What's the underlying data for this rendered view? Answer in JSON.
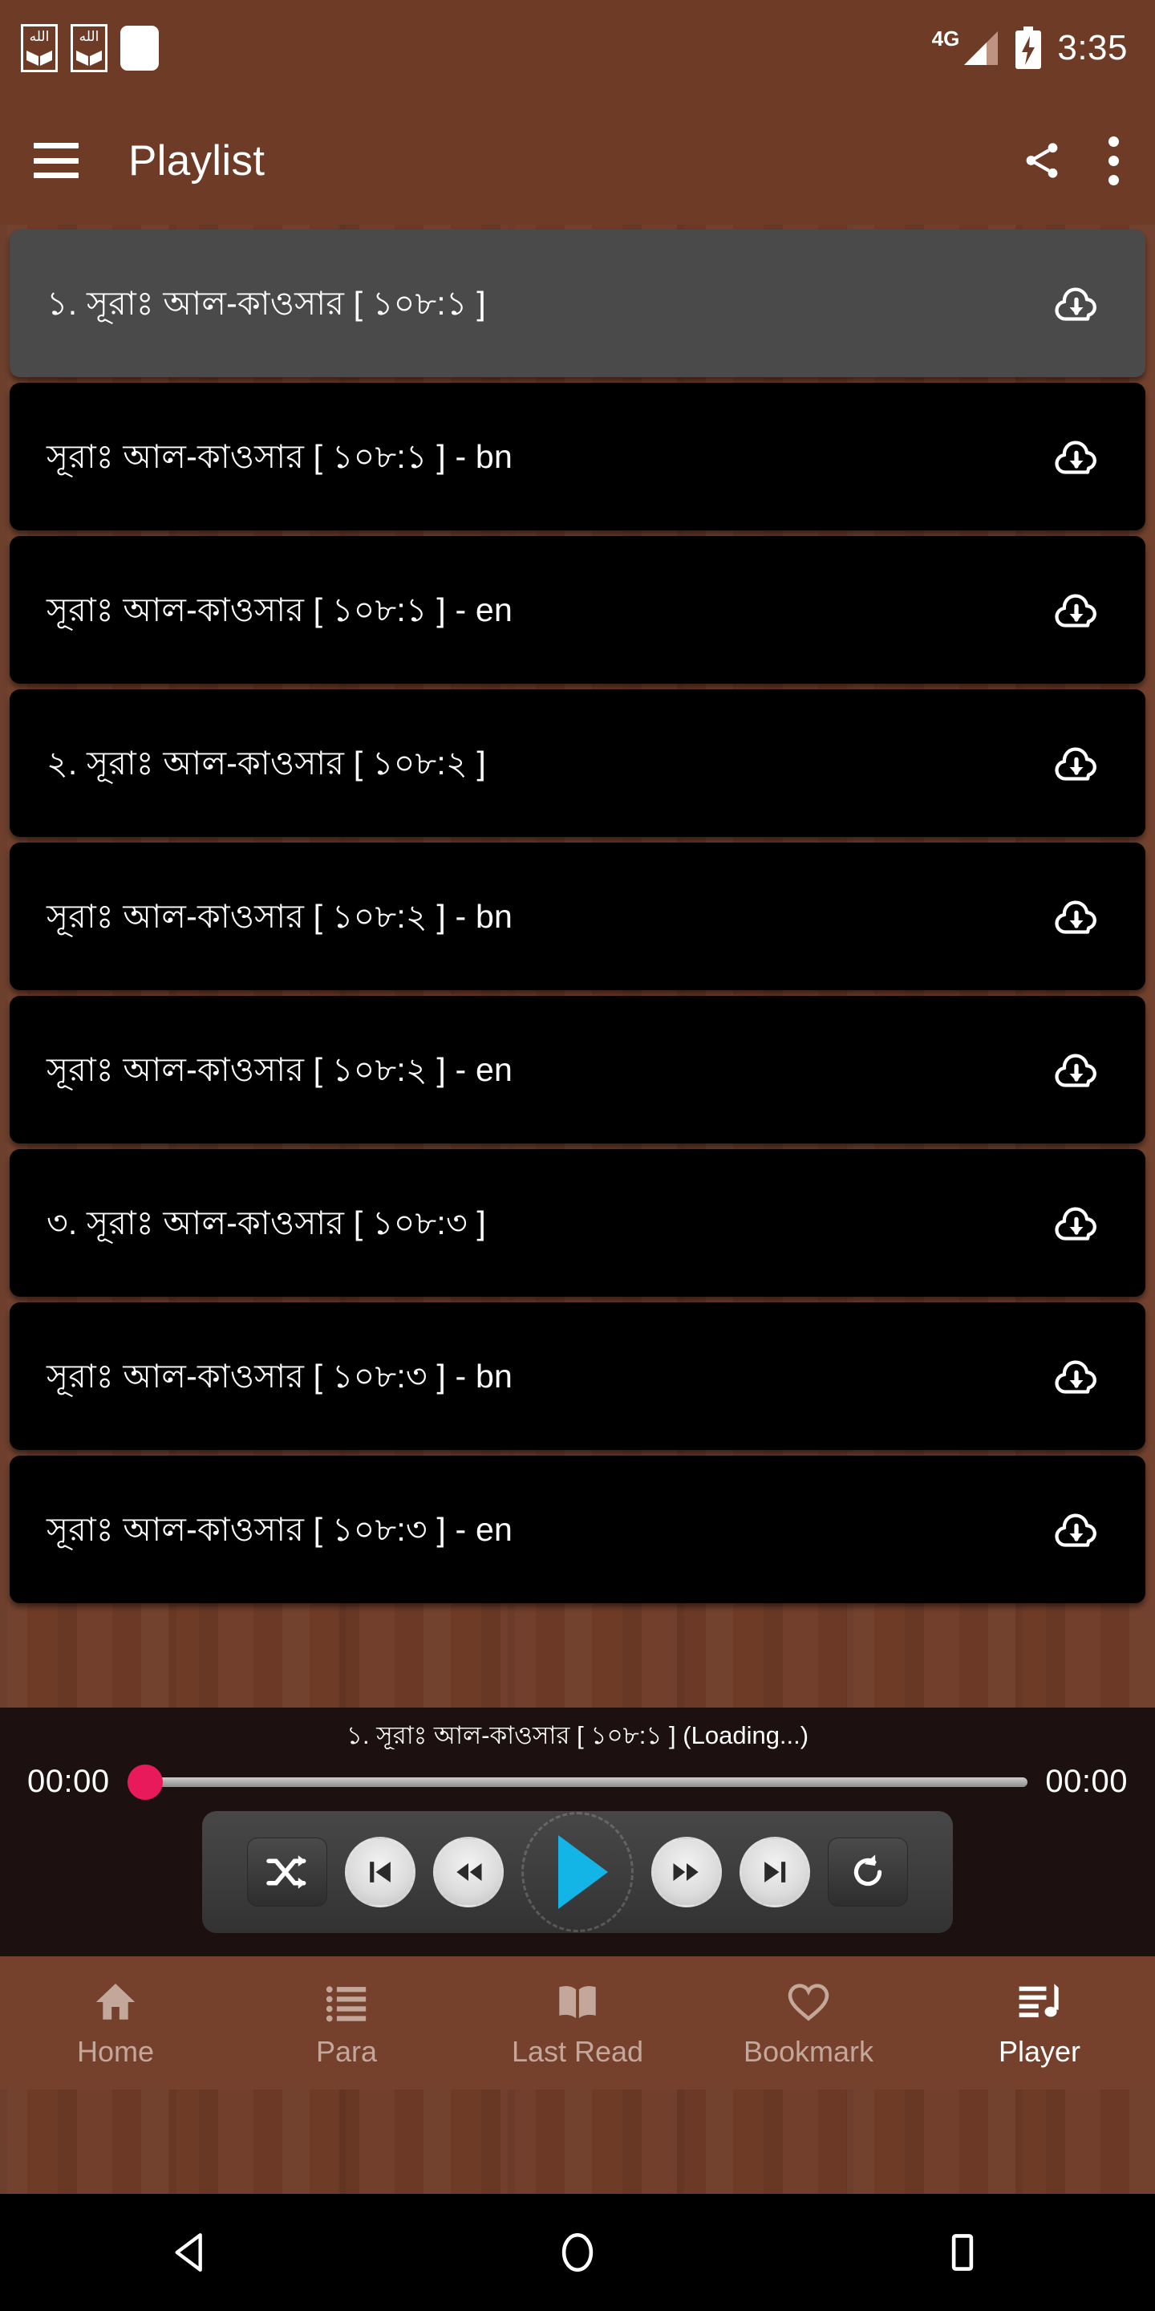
{
  "status_bar": {
    "notification_icons": [
      "quran-app-icon",
      "quran-app-icon",
      "white-notification-chip"
    ],
    "network_type": "4G",
    "signal_icon": "signal-bars-icon",
    "battery_icon": "battery-charging-icon",
    "clock": "3:35"
  },
  "app_bar": {
    "menu_icon": "hamburger-menu-icon",
    "title": "Playlist",
    "share_icon": "share-icon",
    "overflow_icon": "more-vertical-icon"
  },
  "playlist": {
    "download_icon": "cloud-download-icon",
    "tracks": [
      {
        "label": "১.  সূরাঃ আল-কাওসার [ ১০৮:১ ]",
        "selected": true
      },
      {
        "label": "সূরাঃ আল-কাওসার [ ১০৮:১ ] - bn",
        "selected": false
      },
      {
        "label": "সূরাঃ আল-কাওসার [ ১০৮:১ ] - en",
        "selected": false
      },
      {
        "label": "২.  সূরাঃ আল-কাওসার [ ১০৮:২ ]",
        "selected": false
      },
      {
        "label": "সূরাঃ আল-কাওসার [ ১০৮:২ ] - bn",
        "selected": false
      },
      {
        "label": "সূরাঃ আল-কাওসার [ ১০৮:২ ] - en",
        "selected": false
      },
      {
        "label": "৩.  সূরাঃ আল-কাওসার [ ১০৮:৩ ]",
        "selected": false
      },
      {
        "label": "সূরাঃ আল-কাওসার [ ১০৮:৩ ] - bn",
        "selected": false
      },
      {
        "label": "সূরাঃ আল-কাওসার [ ১০৮:৩ ] - en",
        "selected": false
      }
    ]
  },
  "player": {
    "now_playing": "১.  সূরাঃ আল-কাওসার [ ১০৮:১ ] (Loading...)",
    "elapsed_time": "00:00",
    "total_time": "00:00",
    "seek_percent": 0,
    "thumb_color": "#E81A5C",
    "play_color": "#12B5E5",
    "controls": [
      {
        "name": "shuffle-button",
        "icon": "shuffle-icon"
      },
      {
        "name": "previous-button",
        "icon": "skip-previous-icon"
      },
      {
        "name": "rewind-button",
        "icon": "fast-rewind-icon"
      },
      {
        "name": "play-button",
        "icon": "play-icon"
      },
      {
        "name": "fast-forward-button",
        "icon": "fast-forward-icon"
      },
      {
        "name": "next-button",
        "icon": "skip-next-icon"
      },
      {
        "name": "repeat-button",
        "icon": "repeat-icon"
      }
    ]
  },
  "bottom_nav": {
    "items": [
      {
        "label": "Home",
        "icon": "home-icon",
        "active": false
      },
      {
        "label": "Para",
        "icon": "list-icon",
        "active": false
      },
      {
        "label": "Last Read",
        "icon": "open-book-icon",
        "active": false
      },
      {
        "label": "Bookmark",
        "icon": "heart-icon",
        "active": false
      },
      {
        "label": "Player",
        "icon": "queue-music-icon",
        "active": true
      }
    ]
  },
  "android_nav": {
    "back": "back-triangle-icon",
    "home": "home-circle-icon",
    "recents": "recents-square-icon"
  },
  "colors": {
    "app_brown": "#6E3B27",
    "nav_brown": "#76412C",
    "track_black": "#000000",
    "track_selected": "#4A4A4A",
    "player_bg": "#1C1110"
  }
}
